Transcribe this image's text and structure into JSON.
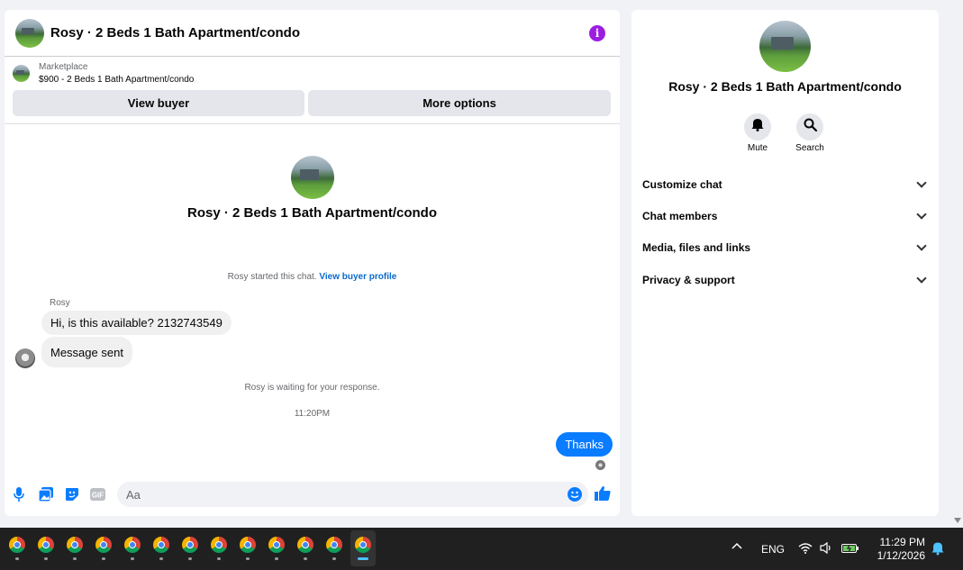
{
  "chat": {
    "title": "Rosy · 2 Beds 1 Bath Apartment/condo",
    "info_glyph": "i",
    "marketplace_label": "Marketplace",
    "listing": "$900 - 2 Beds 1 Bath Apartment/condo",
    "view_buyer": "View buyer",
    "more_options": "More options",
    "intro_title": "Rosy · 2 Beds 1 Bath Apartment/condo",
    "started_text": "Rosy started this chat.",
    "view_buyer_profile": "View buyer profile",
    "messages": [
      {
        "sender": "Rosy",
        "text": "Hi, is this available? 2132743549",
        "direction": "in"
      },
      {
        "sender": "Rosy",
        "text": "Message sent",
        "direction": "in"
      },
      {
        "sender": "me",
        "text": "Thanks",
        "direction": "out"
      }
    ],
    "waiting_note": "Rosy is waiting for your response.",
    "time_note": "11:20PM",
    "composer_placeholder": "Aa",
    "gif_label": "GIF"
  },
  "info_panel": {
    "title": "Rosy · 2 Beds 1 Bath Apartment/condo",
    "mute_label": "Mute",
    "search_label": "Search",
    "sections": [
      "Customize chat",
      "Chat members",
      "Media, files and links",
      "Privacy & support"
    ]
  },
  "taskbar": {
    "app_count": 13,
    "app_icon": "chrome-icon",
    "language": "ENG",
    "time": "11:29 PM",
    "date": "1/12/2026"
  },
  "colors": {
    "accent": "#0a7cff",
    "info_purple": "#9b1ee0",
    "link": "#0a6acc"
  }
}
